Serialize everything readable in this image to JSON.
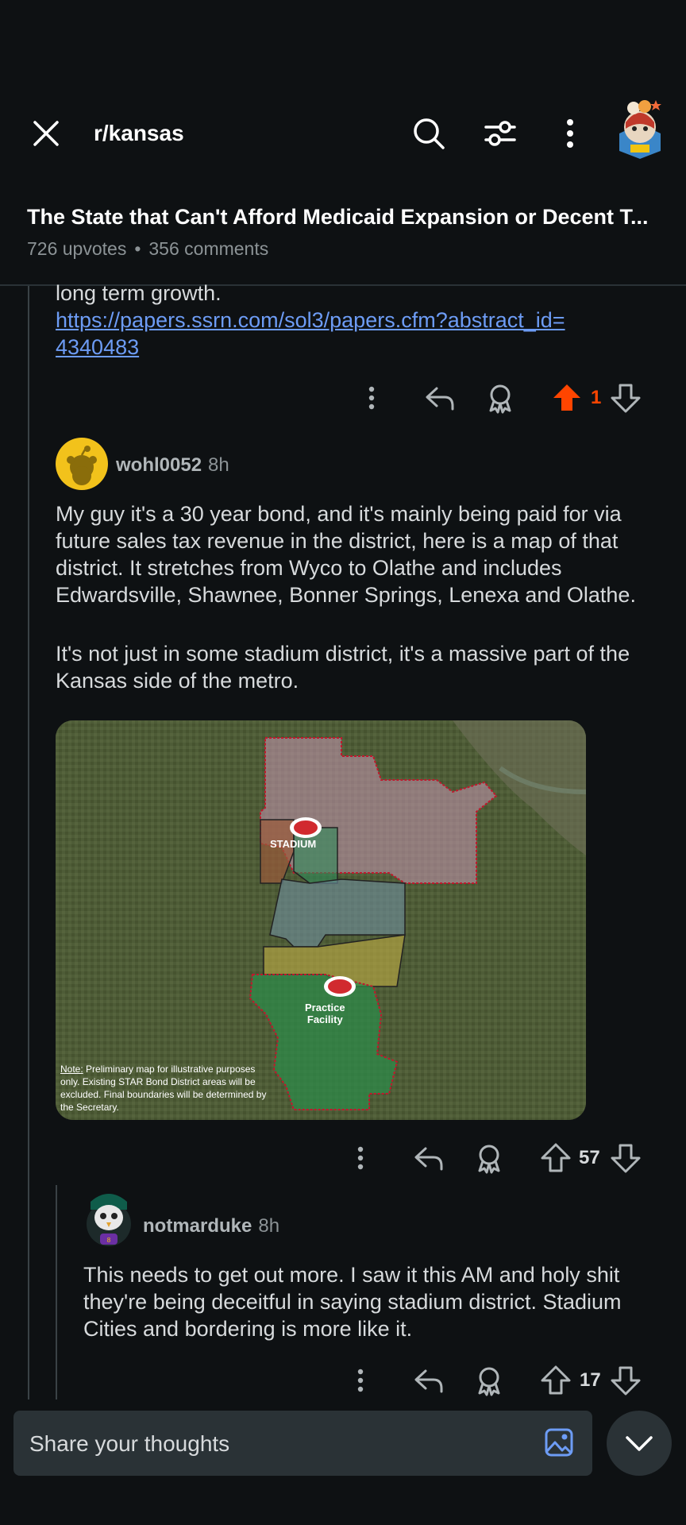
{
  "header": {
    "subreddit": "r/kansas"
  },
  "post": {
    "title": "The State that Can't Afford Medicaid Expansion or Decent T...",
    "upvotes": "726 upvotes",
    "comments": "356 comments"
  },
  "prev_comment": {
    "text_tail": "long term growth.",
    "link": "https://papers.ssrn.com/sol3/papers.cfm?abstract_id=4340483",
    "link_line1": "https://papers.ssrn.com/sol3/papers.cfm?abstract_id=",
    "link_line2": "4340483",
    "score": "1"
  },
  "comment1": {
    "username": "wohl0052",
    "time": "8h",
    "para1": "My guy it's a 30 year bond, and it's mainly being paid for via future sales tax revenue in the district, here is a map of that district. It stretches from Wyco to Olathe and includes Edwardsville, Shawnee, Bonner Springs, Lenexa and Olathe.",
    "para2": "It's not just in some stadium district, it's a massive part of the Kansas side of the metro.",
    "map": {
      "label_stadium": "STADIUM",
      "label_practice_1": "Practice",
      "label_practice_2": "Facility",
      "note_bold": "Note:",
      "note_text": " Preliminary map for illustrative purposes only. Existing STAR Bond District areas will be excluded. Final boundaries will be determined by the Secretary."
    },
    "score": "57"
  },
  "comment2": {
    "username": "notmarduke",
    "time": "8h",
    "text": "This needs to get out more. I saw it this AM and holy shit they're being deceitful in saying stadium district. Stadium Cities and bordering is more like it.",
    "score": "17"
  },
  "composer": {
    "placeholder": "Share your thoughts"
  },
  "colors": {
    "background": "#0e1113",
    "upvote_active": "#ff4500",
    "link": "#6d9cf5"
  },
  "icons": [
    "close-icon",
    "search-icon",
    "filter-icon",
    "more-vertical-icon",
    "reply-icon",
    "award-icon",
    "upvote-icon",
    "downvote-icon",
    "image-icon",
    "chevron-down-icon"
  ]
}
